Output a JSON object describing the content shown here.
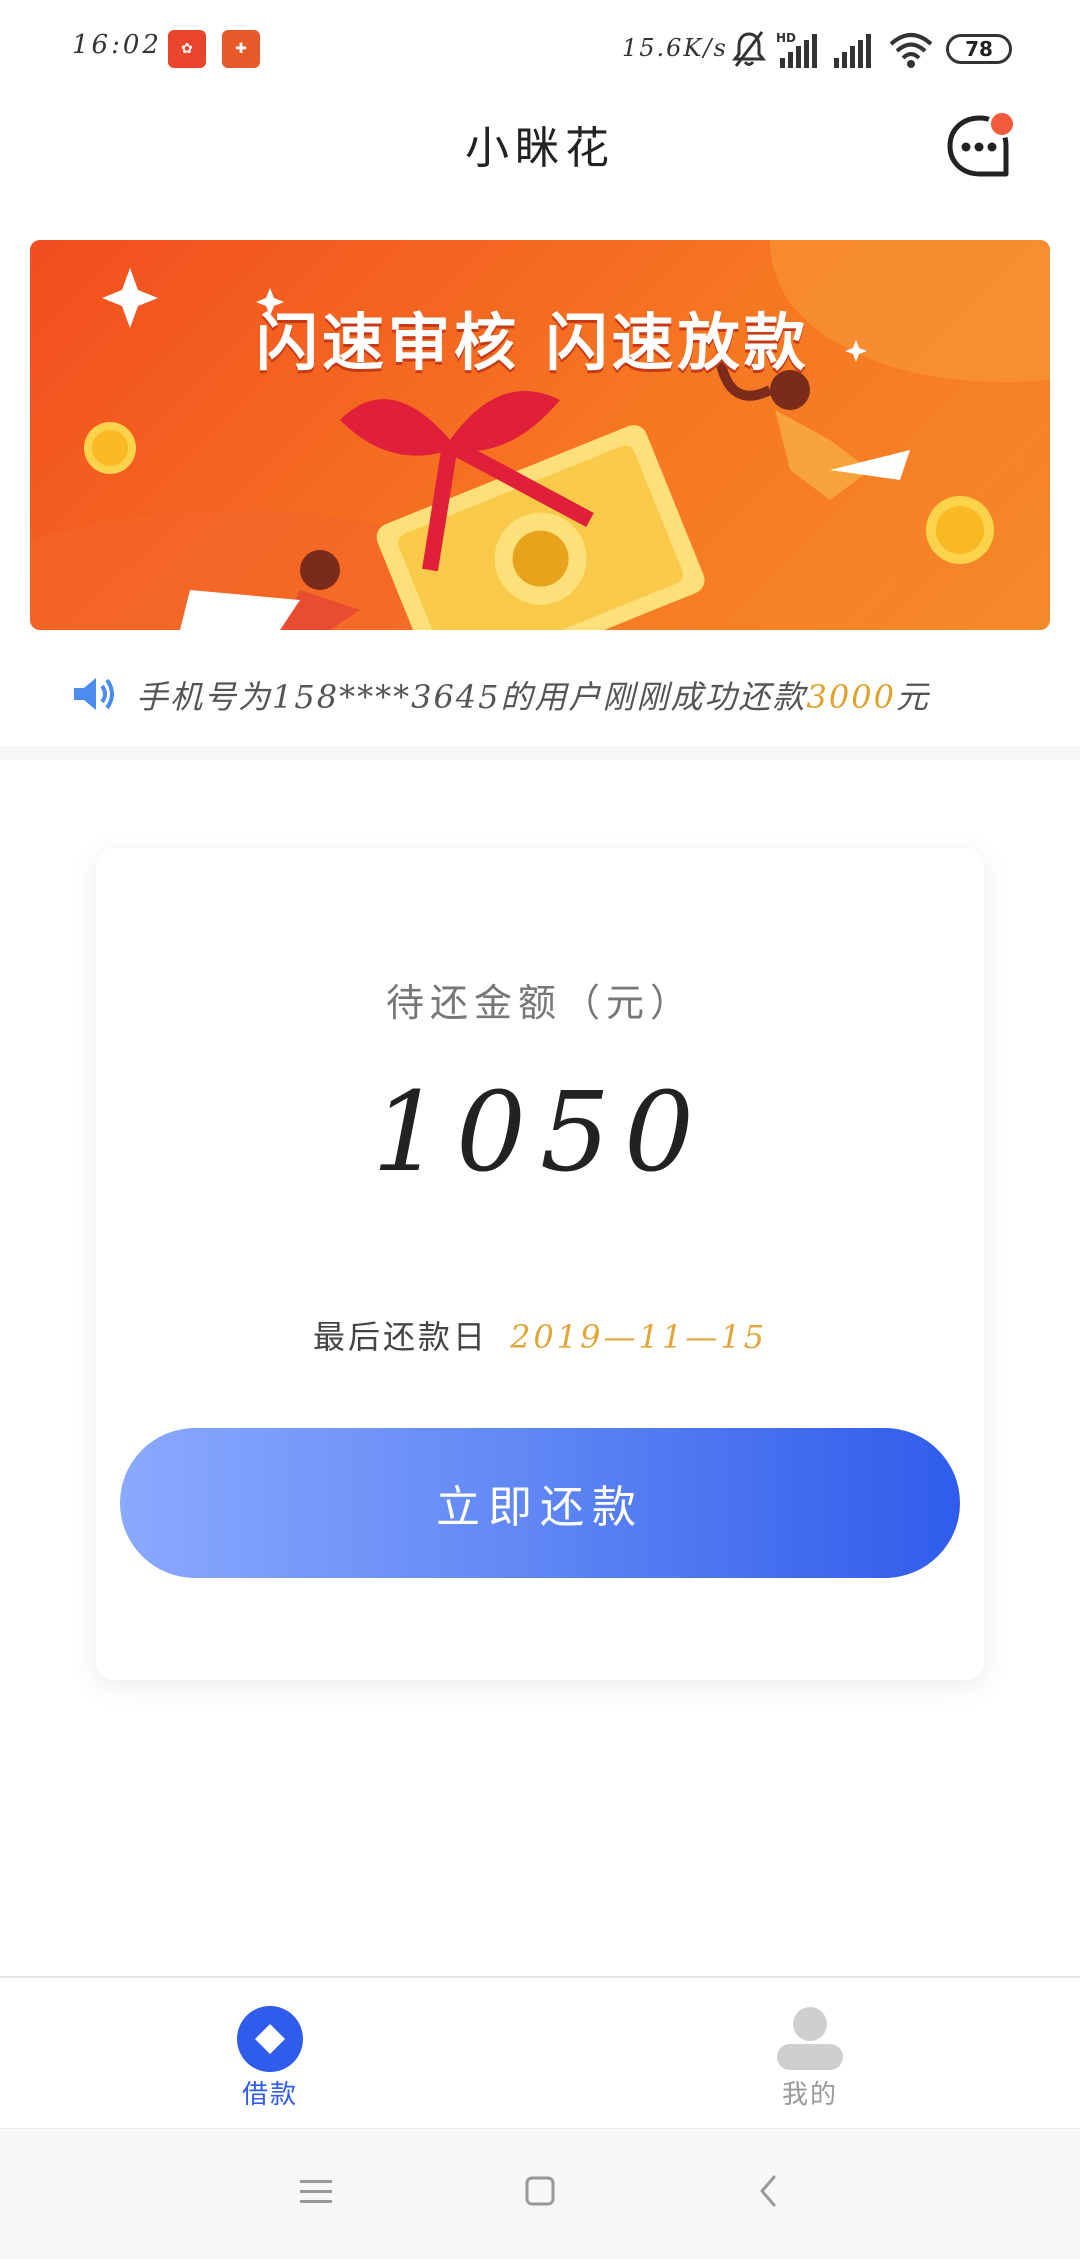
{
  "status_bar": {
    "time": "16:02",
    "net_speed": "15.6K/s",
    "battery": "78"
  },
  "header": {
    "title": "小眯花"
  },
  "banner": {
    "title": "闪速审核 闪速放款"
  },
  "notice": {
    "text_prefix": "手机号为158****3645的用户刚刚成功还款",
    "amount": "3000",
    "text_suffix": "元"
  },
  "card": {
    "label": "待还金额（元）",
    "amount": "1050",
    "due_label": "最后还款日",
    "due_date": "2019—11—15",
    "button_label": "立即还款"
  },
  "tabs": [
    {
      "label": "借款",
      "active": true
    },
    {
      "label": "我的",
      "active": false
    }
  ],
  "colors": {
    "accent": "#2f5ceb",
    "highlight": "#e2a53a",
    "banner": "#f24d1f"
  }
}
